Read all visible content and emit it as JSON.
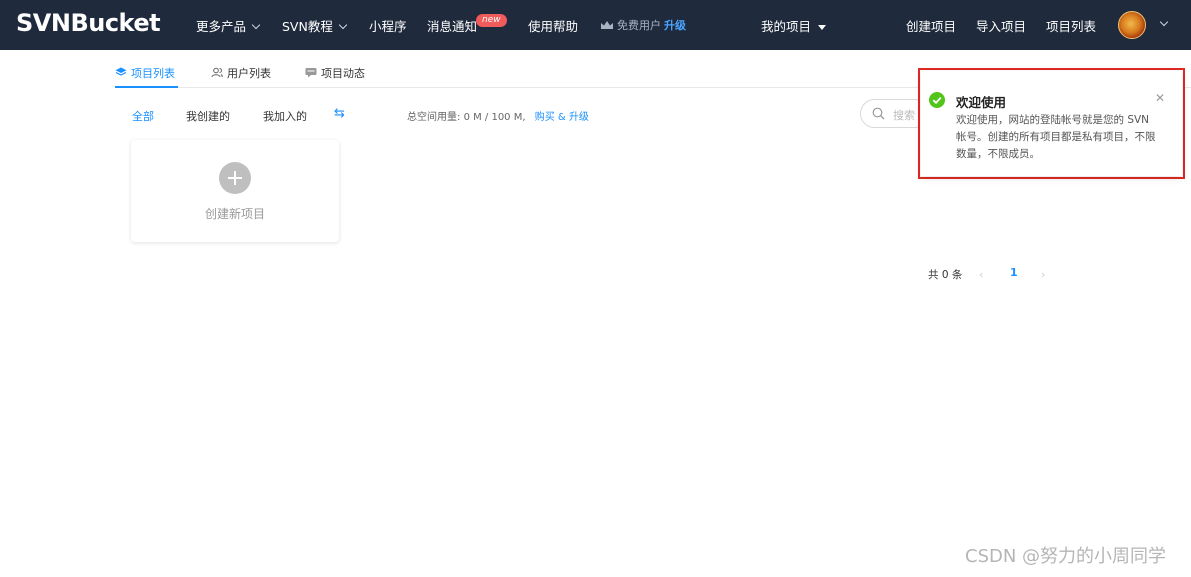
{
  "header": {
    "logo": "SVNBucket",
    "nav": {
      "more_products": "更多产品",
      "svn_tutorial": "SVN教程",
      "mini_program": "小程序",
      "messages": "消息通知",
      "messages_badge": "new",
      "help": "使用帮助",
      "free_user": "免费用户",
      "upgrade": "升级",
      "my_projects": "我的项目",
      "create_project": "创建项目",
      "import_project": "导入项目",
      "project_list": "项目列表"
    },
    "avatar_icon": "avatar-icon"
  },
  "tabs": [
    {
      "label": "项目列表",
      "active": true,
      "icon": "layers-icon"
    },
    {
      "label": "用户列表",
      "active": false,
      "icon": "users-icon"
    },
    {
      "label": "项目动态",
      "active": false,
      "icon": "message-icon"
    }
  ],
  "filters": {
    "all": "全部",
    "created": "我创建的",
    "joined": "我加入的",
    "swap_icon": "swap-icon"
  },
  "storage": {
    "label": "总空间用量:",
    "value": "0 M / 100 M,",
    "link": "购买 & 升级"
  },
  "search": {
    "placeholder": "搜索"
  },
  "create_card": {
    "label": "创建新项目",
    "icon": "plus-circle-icon"
  },
  "pagination": {
    "total": "共 0 条",
    "current_page": "1"
  },
  "notification": {
    "title": "欢迎使用",
    "body": "欢迎使用，网站的登陆帐号就是您的 SVN 帐号。创建的所有项目都是私有项目，不限数量，不限成员。",
    "status_color": "#52c41a",
    "highlight_color": "#e02a22"
  },
  "watermark": "CSDN @努力的小周同学",
  "colors": {
    "nav_bg": "#1f2a3c",
    "accent": "#1890ff"
  }
}
